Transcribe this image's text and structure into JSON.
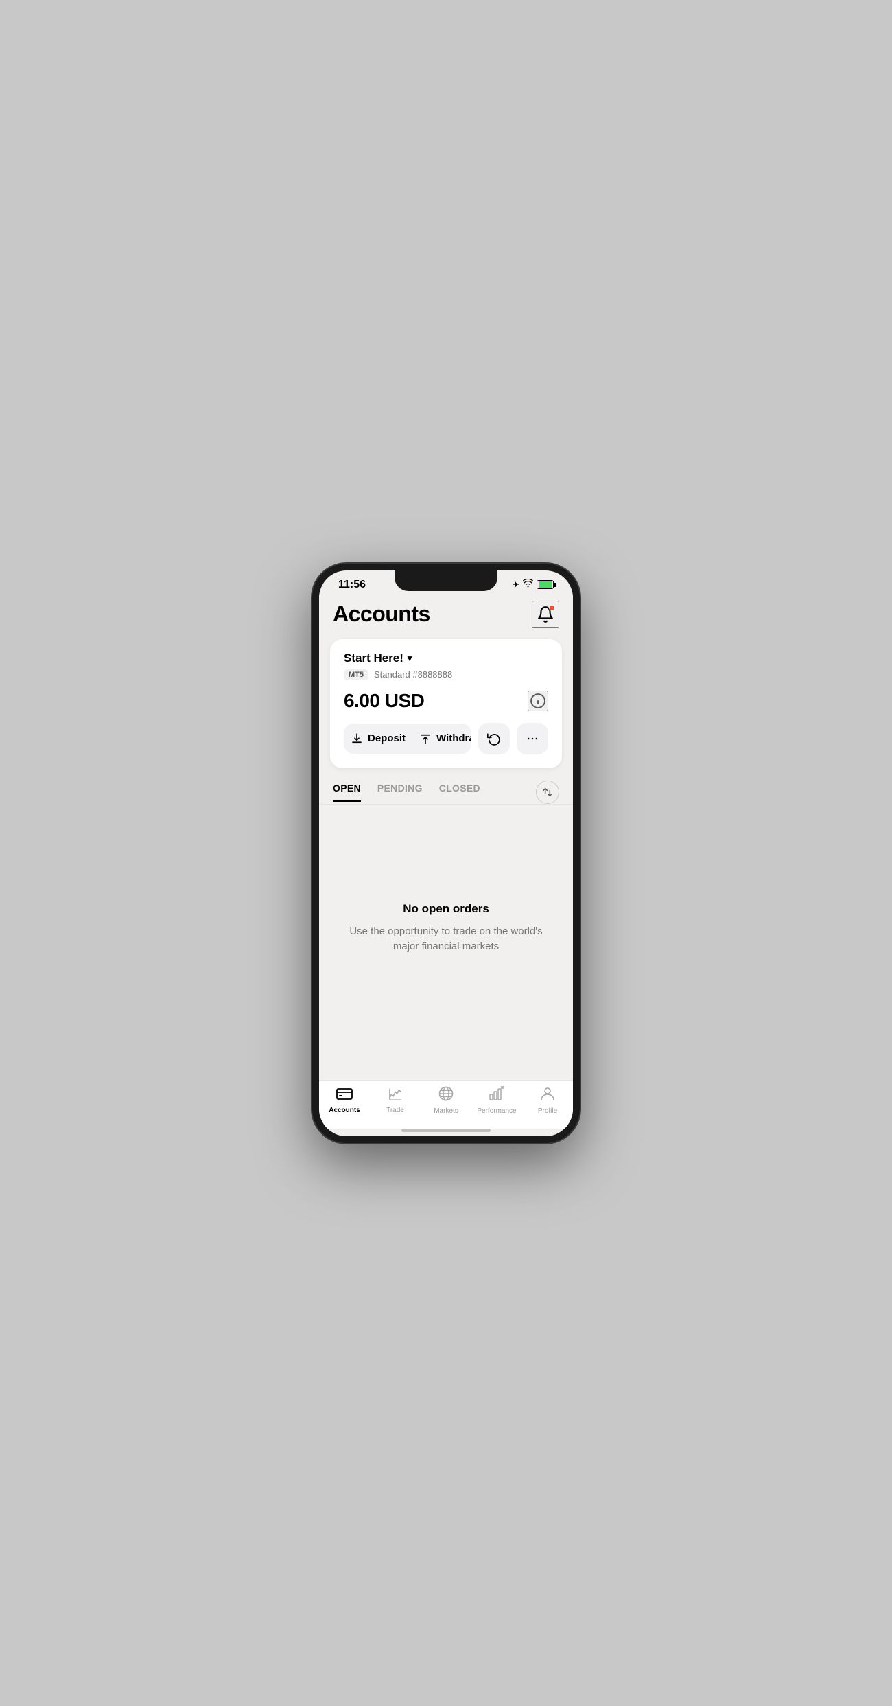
{
  "statusBar": {
    "time": "11:56"
  },
  "header": {
    "title": "Accounts"
  },
  "notification": {
    "hasDot": true
  },
  "accountCard": {
    "name": "Start Here!",
    "platform": "MT5",
    "accountType": "Standard #8888888",
    "balance": "6.00 USD",
    "depositLabel": "Deposit",
    "withdrawLabel": "Withdraw"
  },
  "tabs": [
    {
      "label": "OPEN",
      "active": true
    },
    {
      "label": "PENDING",
      "active": false
    },
    {
      "label": "CLOSED",
      "active": false
    }
  ],
  "emptyState": {
    "title": "No open orders",
    "subtitle": "Use the opportunity to trade on the world's major financial markets"
  },
  "bottomNav": [
    {
      "label": "Accounts",
      "active": true,
      "icon": "accounts"
    },
    {
      "label": "Trade",
      "active": false,
      "icon": "trade"
    },
    {
      "label": "Markets",
      "active": false,
      "icon": "markets"
    },
    {
      "label": "Performance",
      "active": false,
      "icon": "performance"
    },
    {
      "label": "Profile",
      "active": false,
      "icon": "profile"
    }
  ]
}
